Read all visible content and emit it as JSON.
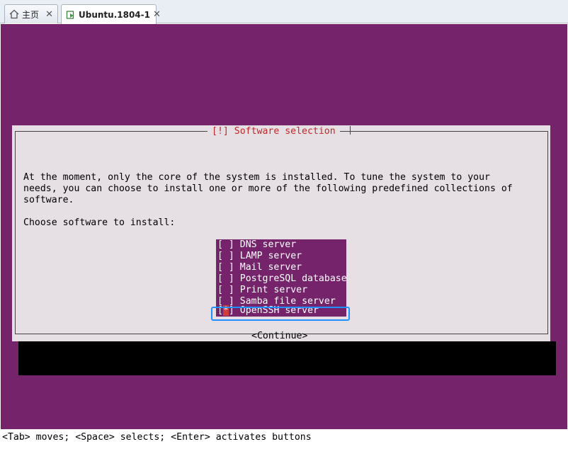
{
  "tabs": [
    {
      "label": "主页",
      "icon": "home-icon",
      "active": false
    },
    {
      "label": "Ubuntu.1804-1",
      "icon": "vm-icon",
      "active": true
    }
  ],
  "tab_close_glyph": "✕",
  "installer": {
    "title": "[!] Software selection",
    "description": "At the moment, only the core of the system is installed. To tune the system to your\nneeds, you can choose to install one or more of the following predefined collections of\nsoftware.",
    "choose_label": "Choose software to install:",
    "items": [
      {
        "mark": "[ ]",
        "label": "DNS server"
      },
      {
        "mark": "[ ]",
        "label": "LAMP server"
      },
      {
        "mark": "[ ]",
        "label": "Mail server"
      },
      {
        "mark": "[ ]",
        "label": "PostgreSQL database"
      },
      {
        "mark": "[ ]",
        "label": "Print server"
      },
      {
        "mark": "[ ]",
        "label": "Samba file server"
      }
    ],
    "selected_item": {
      "mark_open": "[",
      "mark_star": "*",
      "mark_close": "]",
      "label": "OpenSSH server"
    },
    "continue_button": "<Continue>"
  },
  "status_line": "<Tab> moves; <Space> selects; <Enter> activates buttons",
  "colors": {
    "console_bg": "#75246b",
    "dialog_bg": "#e6dfe4",
    "title_text": "#c0292a",
    "highlight_border": "#1e90ff"
  }
}
